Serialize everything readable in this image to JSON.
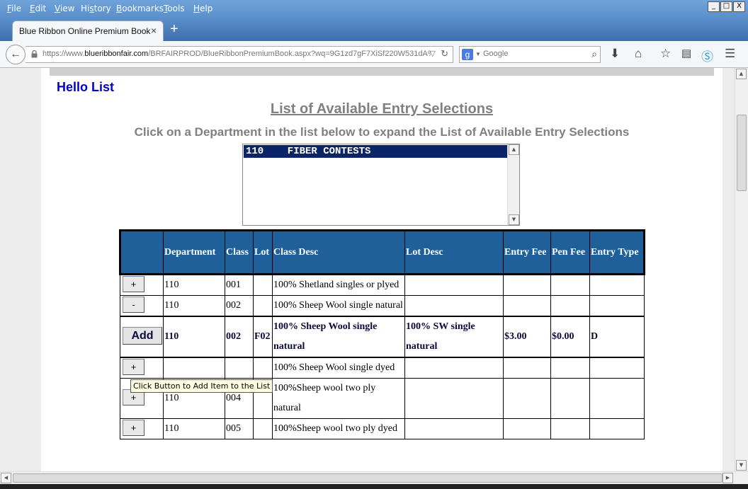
{
  "menu": [
    "File",
    "Edit",
    "View",
    "History",
    "Bookmarks",
    "Tools",
    "Help"
  ],
  "menu_access_keys": [
    "F",
    "E",
    "V",
    "s",
    "B",
    "T",
    "H"
  ],
  "window_controls": [
    "_",
    "□",
    "X"
  ],
  "tab": {
    "title": "Blue Ribbon Online Premium Book",
    "close": "×",
    "new_tab": "+"
  },
  "nav": {
    "url_prefix": "https://www.",
    "url_domain": "blueribbonfair.com",
    "url_path": "/BRFAIRPROD/BlueRibbonPremiumBook.aspx?wq=9G1zd7gF7XiSf220W531dA%",
    "search_placeholder": "Google"
  },
  "page": {
    "greeting": "Hello List",
    "title": "List of Available Entry Selections",
    "instructions": "Click on a Department in the list below to expand the List of Available Entry Selections",
    "department_list": [
      "110    FIBER CONTESTS"
    ]
  },
  "table": {
    "headers": [
      "",
      "Department",
      "Class",
      "Lot",
      "Class Desc",
      "Lot Desc",
      "Entry Fee",
      "Pen Fee",
      "Entry Type"
    ],
    "rows": [
      {
        "button": "+",
        "department": "110",
        "class": "001",
        "lot": "",
        "class_desc": "100% Shetland singles or plyed",
        "lot_desc": "",
        "entry_fee": "",
        "pen_fee": "",
        "entry_type": ""
      },
      {
        "button": "-",
        "department": "110",
        "class": "002",
        "lot": "",
        "class_desc": "100% Sheep Wool single natural",
        "lot_desc": "",
        "entry_fee": "",
        "pen_fee": "",
        "entry_type": ""
      },
      {
        "button": "Add",
        "department": "110",
        "class": "002",
        "lot": "F02",
        "class_desc": "100% Sheep Wool single natural",
        "lot_desc": "100% SW single natural",
        "entry_fee": "$3.00",
        "pen_fee": "$0.00",
        "entry_type": "D"
      },
      {
        "button": "+",
        "department": "",
        "class": "",
        "lot": "",
        "class_desc": "100% Sheep Wool single dyed",
        "lot_desc": "",
        "entry_fee": "",
        "pen_fee": "",
        "entry_type": ""
      },
      {
        "button": "+",
        "department": "110",
        "class": "004",
        "lot": "",
        "class_desc": "100%Sheep wool two ply natural",
        "lot_desc": "",
        "entry_fee": "",
        "pen_fee": "",
        "entry_type": ""
      },
      {
        "button": "+",
        "department": "110",
        "class": "005",
        "lot": "",
        "class_desc": "100%Sheep wool two ply dyed",
        "lot_desc": "",
        "entry_fee": "",
        "pen_fee": "",
        "entry_type": ""
      }
    ]
  },
  "tooltip": "Click Button to Add Item to the List",
  "colors": {
    "header_bg": "#1f5f9a",
    "greeting": "#0000cc",
    "selected_list": "#0a246a",
    "muted_title": "#808080"
  }
}
